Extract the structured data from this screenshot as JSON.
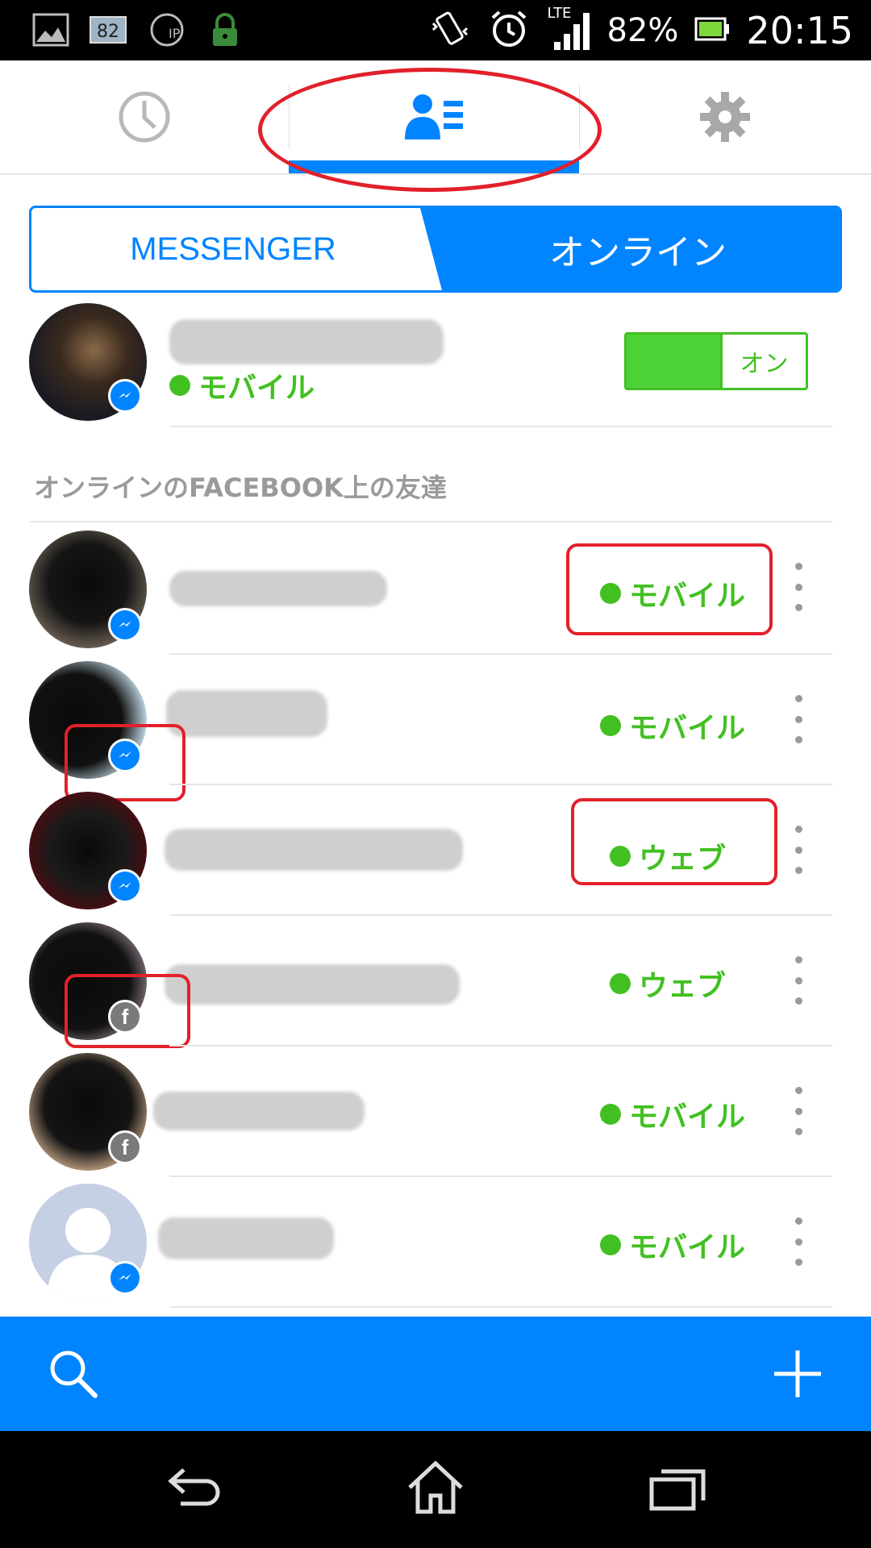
{
  "status_bar": {
    "notification_badge": "82",
    "battery_percent": "82%",
    "time": "20:15",
    "network": "LTE",
    "icons": [
      "image-icon",
      "battery-temp-icon",
      "ip-phone-icon",
      "lock-icon",
      "vibrate-icon",
      "alarm-icon",
      "signal-icon",
      "battery-icon"
    ]
  },
  "tabs": [
    {
      "id": "recent",
      "icon": "clock-icon"
    },
    {
      "id": "people",
      "icon": "people-list-icon",
      "active": true
    },
    {
      "id": "settings",
      "icon": "gear-icon"
    }
  ],
  "segment": {
    "left_label": "MESSENGER",
    "right_label": "オンライン",
    "selected": "right"
  },
  "me": {
    "status": "モバイル",
    "toggle_label": "オン",
    "toggle_on": true
  },
  "section_header": "オンラインのFACEBOOK上の友達",
  "friends": [
    {
      "status": "モバイル",
      "badge": "messenger"
    },
    {
      "status": "モバイル",
      "badge": "messenger"
    },
    {
      "status": "ウェブ",
      "badge": "messenger"
    },
    {
      "status": "ウェブ",
      "badge": "facebook"
    },
    {
      "status": "モバイル",
      "badge": "facebook"
    },
    {
      "status": "モバイル",
      "badge": "messenger"
    }
  ],
  "bottom_bar": {
    "left_icon": "search-icon",
    "right_icon": "plus-icon"
  },
  "nav_bar": {
    "icons": [
      "back-icon",
      "home-icon",
      "recents-icon"
    ]
  },
  "colors": {
    "accent": "#0084ff",
    "online": "#42c022",
    "annotation": "#e2202a"
  }
}
